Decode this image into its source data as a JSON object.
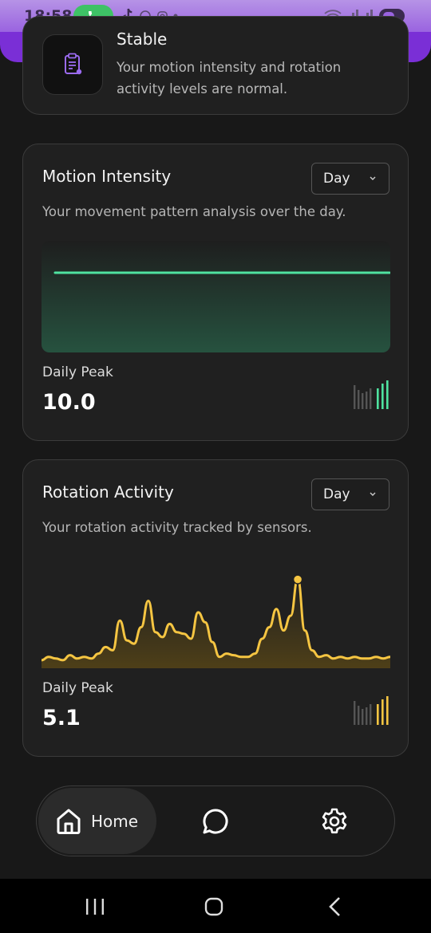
{
  "status_bar": {
    "time": "18:58",
    "icons": [
      "phone-call-icon",
      "tiktok-icon",
      "whatsapp-icon",
      "instagram-icon",
      "dot-icon",
      "wifi-icon",
      "signal-icon",
      "battery-icon"
    ]
  },
  "status_card": {
    "title": "Stable",
    "description": "Your motion intensity and rotation activity levels are normal.",
    "icon": "clipboard-icon",
    "accent": "#8b5cf6"
  },
  "motion_card": {
    "title": "Motion Intensity",
    "subtitle": "Your movement pattern analysis over the day.",
    "period": "Day",
    "peak_label": "Daily Peak",
    "peak_value": "10.0",
    "color": "#4fe3a0"
  },
  "rotation_card": {
    "title": "Rotation Activity",
    "subtitle": "Your rotation activity tracked by sensors.",
    "period": "Day",
    "peak_label": "Daily Peak",
    "peak_value": "5.1",
    "color": "#f5c542"
  },
  "chart_data": [
    {
      "type": "area",
      "series": [
        {
          "values": [
            10.0,
            10.0,
            10.0,
            10.0,
            10.0,
            10.0,
            10.0,
            10.0,
            10.0,
            10.0,
            10.0,
            10.0
          ]
        }
      ],
      "ylim": [
        0,
        13
      ],
      "grid": false,
      "legend": "none"
    },
    {
      "type": "area",
      "series": [
        {
          "values": [
            0.2,
            0.4,
            0.3,
            0.2,
            0.5,
            0.3,
            0.4,
            0.3,
            0.6,
            1.0,
            0.8,
            2.6,
            1.4,
            1.2,
            2.2,
            3.8,
            1.9,
            1.6,
            2.4,
            1.9,
            1.8,
            1.5,
            3.1,
            2.5,
            1.3,
            0.4,
            0.6,
            0.5,
            0.4,
            0.4,
            0.6,
            1.5,
            2.2,
            3.3,
            2.0,
            2.9,
            5.1,
            2.0,
            0.8,
            0.4,
            0.5,
            0.3,
            0.4,
            0.3,
            0.4,
            0.3,
            0.3,
            0.4,
            0.3,
            0.4
          ]
        }
      ],
      "ylim": [
        0,
        6
      ],
      "grid": false,
      "legend": "none",
      "highlight_index": 36
    }
  ],
  "nav": {
    "home_label": "Home",
    "items": [
      "home-icon",
      "chat-icon",
      "settings-icon"
    ]
  }
}
